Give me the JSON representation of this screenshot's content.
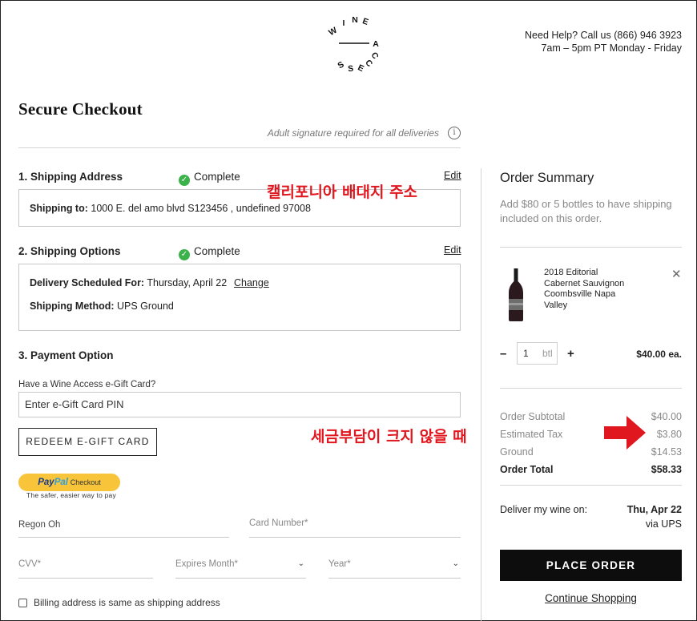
{
  "brand": {
    "logo_text": "WINE ACCESS",
    "icon": "wine-access-logo"
  },
  "help": {
    "line1": "Need Help? Call us (866) 946 3923",
    "line2": "7am – 5pm PT Monday - Friday"
  },
  "page_title": "Secure Checkout",
  "adult_notice": "Adult signature required for all deliveries",
  "info_icon": "i",
  "shipping_address": {
    "title": "1. Shipping Address",
    "status": "Complete",
    "edit": "Edit",
    "label": "Shipping to:",
    "value": " 1000 E. del amo blvd S123456 , undefined 97008"
  },
  "shipping_options": {
    "title": "2. Shipping Options",
    "status": "Complete",
    "edit": "Edit",
    "delivery_label": "Delivery Scheduled For:",
    "delivery_value": " Thursday, April 22",
    "change": "Change",
    "method_label": "Shipping Method:",
    "method_value": " UPS Ground"
  },
  "annotations": {
    "ca_address": "캘리포니아 배대지 주소",
    "tax_note": "세금부담이 크지 않을 때",
    "arrow_color": "#e0171f"
  },
  "payment": {
    "title": "3. Payment Option",
    "gift_label": "Have a Wine Access e-Gift Card?",
    "gift_placeholder": "Enter e-Gift Card PIN",
    "redeem_button": "REDEEM E-GIFT CARD",
    "paypal_pay": "Pay",
    "paypal_pal": "Pal",
    "paypal_checkout": "Checkout",
    "paypal_tagline": "The safer, easier way to pay",
    "name_value": "Regon Oh",
    "card_number_placeholder": "Card Number*",
    "cvv_placeholder": "CVV*",
    "expires_month_placeholder": "Expires Month*",
    "year_placeholder": "Year*",
    "billing_same": "Billing address is same as shipping address"
  },
  "order_summary": {
    "title": "Order Summary",
    "note": "Add $80 or 5 bottles to have shipping included on this order.",
    "product": {
      "name_lines": [
        "2018 Editorial",
        "Cabernet Sauvignon",
        "Coombsville Napa",
        "Valley"
      ],
      "quantity": "1",
      "unit": "btl",
      "price": "$40.00 ea."
    },
    "rows": [
      {
        "label": "Order Subtotal",
        "value": "$40.00"
      },
      {
        "label": "Estimated Tax",
        "value": "$3.80"
      },
      {
        "label": "Ground",
        "value": "$14.53"
      }
    ],
    "total": {
      "label": "Order Total",
      "value": "$58.33"
    },
    "deliver_label": "Deliver my wine on:",
    "deliver_date": "Thu, Apr 22",
    "deliver_via": "via UPS",
    "place_order": "PLACE ORDER",
    "continue_shopping": "Continue Shopping"
  },
  "colors": {
    "accent_black": "#0d0d0d",
    "check_green": "#3bb24a",
    "paypal_yellow": "#f7c43a",
    "annotation_red": "#e0171f"
  }
}
